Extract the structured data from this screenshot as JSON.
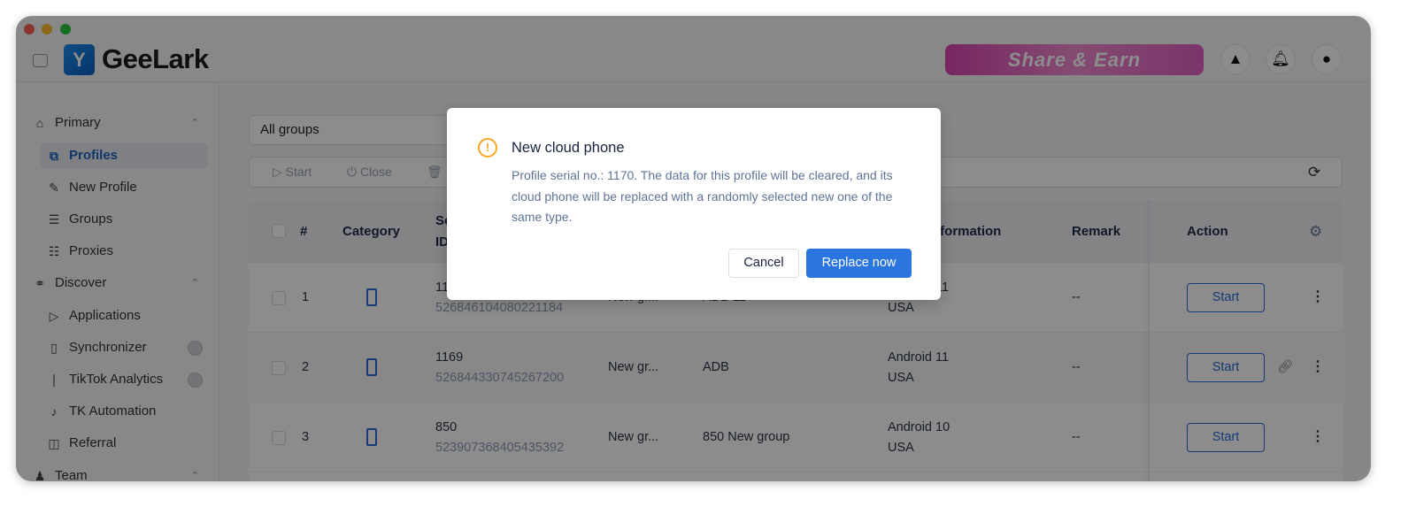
{
  "app": {
    "name": "GeeLark",
    "banner": "Share & Earn"
  },
  "sidebar": {
    "sections": [
      {
        "label": "Primary",
        "icon": "home-icon"
      },
      {
        "label": "Discover",
        "icon": "planet-icon"
      },
      {
        "label": "Team",
        "icon": "users-icon"
      }
    ],
    "items": [
      {
        "label": "Profiles",
        "icon": "profiles-icon",
        "active": true
      },
      {
        "label": "New Profile",
        "icon": "edit-icon"
      },
      {
        "label": "Groups",
        "icon": "list-icon"
      },
      {
        "label": "Proxies",
        "icon": "network-icon"
      },
      {
        "label": "Applications",
        "icon": "apps-icon"
      },
      {
        "label": "Synchronizer",
        "icon": "sync-phone-icon"
      },
      {
        "label": "TikTok Analytics",
        "icon": "chart-icon"
      },
      {
        "label": "TK Automation",
        "icon": "tiktok-icon"
      },
      {
        "label": "Referral",
        "icon": "gift-icon"
      }
    ]
  },
  "filter": {
    "group": "All groups"
  },
  "toolbar": {
    "start": "Start",
    "close": "Close"
  },
  "table": {
    "headers": {
      "num": "#",
      "category": "Category",
      "serial": "Se",
      "serial2": "ID",
      "info": "nformation",
      "remark": "Remark",
      "action": "Action"
    },
    "rows": [
      {
        "num": "1",
        "serial": "11",
        "id": "526846104080221184",
        "group": "New gr...",
        "name": "ADB 11",
        "os": "Android 11",
        "country": "USA",
        "remark": "--",
        "start": "Start"
      },
      {
        "num": "2",
        "serial": "1169",
        "id": "526844330745267200",
        "group": "New gr...",
        "name": "ADB",
        "os": "Android 11",
        "country": "USA",
        "remark": "--",
        "start": "Start"
      },
      {
        "num": "3",
        "serial": "850",
        "id": "523907368405435392",
        "group": "New gr...",
        "name": "850 New group",
        "os": "Android 10",
        "country": "USA",
        "remark": "--",
        "start": "Start"
      }
    ]
  },
  "dialog": {
    "title": "New cloud phone",
    "body": "Profile serial no.: 1170. The data for this profile will be cleared, and its cloud phone will be replaced with a randomly selected new one of the same type.",
    "cancel": "Cancel",
    "confirm": "Replace now"
  },
  "colors": {
    "accent": "#2a75e0",
    "warning": "#f5a623"
  }
}
